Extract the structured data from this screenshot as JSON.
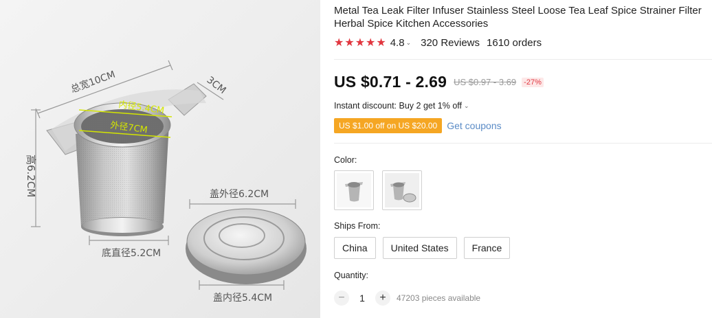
{
  "product": {
    "title": "Metal Tea Leak Filter Infuser Stainless Steel Loose Tea Leaf Spice Strainer Filter Herbal Spice Kitchen Accessories",
    "image_labels": {
      "total_width": "总宽10CM",
      "handle": "3CM",
      "inner_dia": "内径5.4CM",
      "outer_dia": "外径7CM",
      "height": "高6.2CM",
      "lid_outer": "盖外径6.2CM",
      "base_dia": "底直径5.2CM",
      "lid_inner": "盖内径5.4CM"
    }
  },
  "rating": {
    "stars": 5,
    "value": "4.8",
    "reviews": "320 Reviews",
    "orders": "1610 orders"
  },
  "price": {
    "current": "US $0.71 - 2.69",
    "original": "US $0.97 - 3.69",
    "discount": "-27%"
  },
  "promo": {
    "instant_discount": "Instant discount: Buy 2 get 1% off",
    "coupon_badge": "US $1.00 off on US $20.00",
    "get_coupons": "Get coupons"
  },
  "color": {
    "label": "Color:",
    "options": [
      "infuser",
      "infuser-with-lid"
    ]
  },
  "ships_from": {
    "label": "Ships From:",
    "options": [
      "China",
      "United States",
      "France"
    ]
  },
  "quantity": {
    "label": "Quantity:",
    "value": "1",
    "available": "47203 pieces available",
    "minus": "−",
    "plus": "+"
  },
  "colors": {
    "star": "#e1363f",
    "coupon": "#f5a623",
    "link": "#5a8bc6",
    "dimension_line": "#999999",
    "dimension_text": "#555555",
    "highlight": "#d4e600"
  }
}
